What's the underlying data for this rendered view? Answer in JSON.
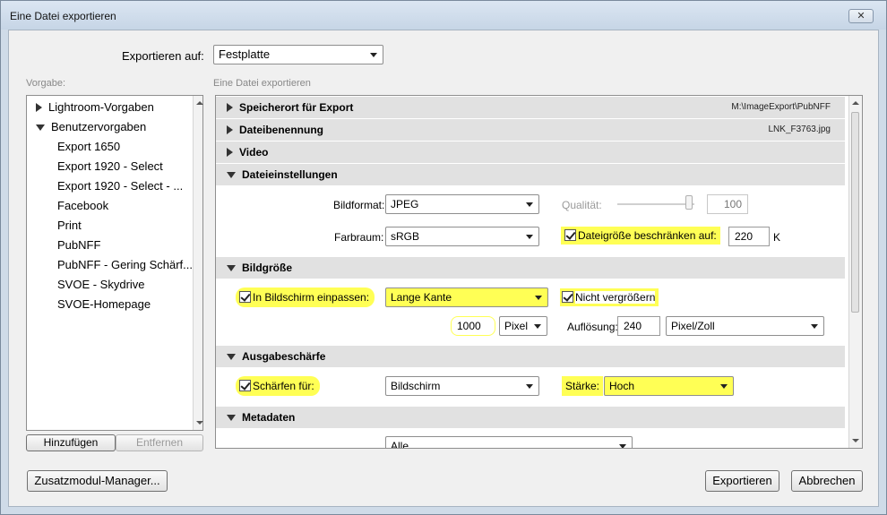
{
  "window": {
    "title": "Eine Datei exportieren",
    "close_glyph": "✕"
  },
  "export_to": {
    "label": "Exportieren auf:",
    "value": "Festplatte"
  },
  "presets": {
    "header": "Vorgabe:",
    "items": [
      {
        "label": "Lightroom-Vorgaben",
        "type": "folder-collapsed"
      },
      {
        "label": "Benutzervorgaben",
        "type": "folder-expanded"
      },
      {
        "label": "Export 1650",
        "type": "preset"
      },
      {
        "label": "Export 1920 - Select",
        "type": "preset"
      },
      {
        "label": "Export 1920 - Select - ...",
        "type": "preset"
      },
      {
        "label": "Facebook",
        "type": "preset"
      },
      {
        "label": "Print",
        "type": "preset"
      },
      {
        "label": "PubNFF",
        "type": "preset"
      },
      {
        "label": "PubNFF - Gering Schärf...",
        "type": "preset"
      },
      {
        "label": "SVOE - Skydrive",
        "type": "preset"
      },
      {
        "label": "SVOE-Homepage",
        "type": "preset"
      }
    ],
    "add_button": "Hinzufügen",
    "remove_button": "Entfernen"
  },
  "main": {
    "header": "Eine Datei exportieren",
    "sections": {
      "export_location": {
        "title": "Speicherort für Export",
        "value": "M:\\ImageExport\\PubNFF",
        "expanded": false
      },
      "file_naming": {
        "title": "Dateibenennung",
        "value": "LNK_F3763.jpg",
        "expanded": false
      },
      "video": {
        "title": "Video",
        "expanded": false
      },
      "file_settings": {
        "title": "Dateieinstellungen",
        "expanded": true,
        "format_label": "Bildformat:",
        "format_value": "JPEG",
        "quality_label": "Qualität:",
        "quality_value": "100",
        "colorspace_label": "Farbraum:",
        "colorspace_value": "sRGB",
        "limit_size_label": "Dateigröße beschränken auf:",
        "limit_size_checked": true,
        "limit_size_value": "220",
        "limit_size_unit": "K"
      },
      "image_sizing": {
        "title": "Bildgröße",
        "expanded": true,
        "fit_label": "In Bildschirm einpassen:",
        "fit_checked": true,
        "fit_value": "Lange Kante",
        "no_enlarge_label": "Nicht vergrößern",
        "no_enlarge_checked": true,
        "size_value": "1000",
        "size_unit": "Pixel",
        "resolution_label": "Auflösung:",
        "resolution_value": "240",
        "resolution_unit": "Pixel/Zoll"
      },
      "output_sharpening": {
        "title": "Ausgabeschärfe",
        "expanded": true,
        "sharpen_label": "Schärfen für:",
        "sharpen_checked": true,
        "sharpen_value": "Bildschirm",
        "amount_label": "Stärke:",
        "amount_value": "Hoch"
      },
      "metadata": {
        "title": "Metadaten",
        "expanded": true,
        "value": "Alle"
      }
    }
  },
  "footer": {
    "plugin_manager": "Zusatzmodul-Manager...",
    "export": "Exportieren",
    "cancel": "Abbrechen"
  },
  "colors": {
    "highlight": "#ffff55",
    "section_bg": "#e1e1e1",
    "titlebar": "#c6d5e6"
  }
}
